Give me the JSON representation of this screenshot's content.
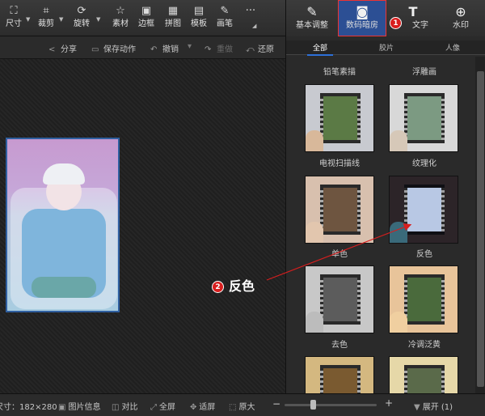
{
  "toolbar": {
    "items": [
      {
        "label": "尺寸",
        "icon": "resize-icon"
      },
      {
        "label": "裁剪",
        "icon": "crop-icon"
      },
      {
        "label": "旋转",
        "icon": "rotate-icon"
      },
      {
        "label": "素材",
        "icon": "star-icon"
      },
      {
        "label": "边框",
        "icon": "frame-icon"
      },
      {
        "label": "拼图",
        "icon": "collage-icon"
      },
      {
        "label": "模板",
        "icon": "template-icon"
      },
      {
        "label": "画笔",
        "icon": "brush-icon"
      },
      {
        "label": "···",
        "icon": "more-icon"
      }
    ]
  },
  "subbar": {
    "share": "分享",
    "save_action": "保存动作",
    "undo": "撤销",
    "redo": "重做",
    "restore": "还原"
  },
  "panel": {
    "tabs": [
      {
        "label": "基本调整",
        "icon": "adjust-icon"
      },
      {
        "label": "数码暗房",
        "icon": "camera-icon"
      },
      {
        "label": "文字",
        "icon": "text-icon"
      },
      {
        "label": "水印",
        "icon": "watermark-icon"
      }
    ],
    "subtabs": [
      "全部",
      "胶片",
      "人像"
    ],
    "effects": [
      {
        "label": "铅笔素描"
      },
      {
        "label": "浮雕画"
      },
      {
        "label": "电视扫描线"
      },
      {
        "label": "纹理化"
      },
      {
        "label": "单色"
      },
      {
        "label": "反色"
      },
      {
        "label": "去色"
      },
      {
        "label": "冷调泛黄"
      }
    ]
  },
  "status": {
    "size": "尺寸：182×280",
    "info": "图片信息",
    "compare": "对比",
    "fullscreen": "全屏",
    "fit": "适屏",
    "original": "原大",
    "expand": "展开 (1)"
  },
  "annotations": {
    "step1": "1",
    "step2": "2",
    "step2_label": "反色"
  },
  "colors": {
    "active_tab": "#2c4f94",
    "highlight": "#e33333",
    "annotation": "#d81e1e"
  }
}
